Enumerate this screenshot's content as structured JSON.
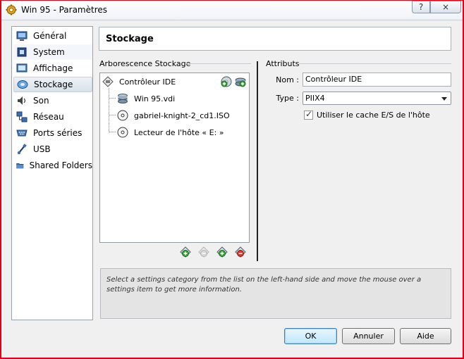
{
  "window": {
    "title": "Win 95 - Paramètres",
    "help_btn": "?",
    "close_btn": "×"
  },
  "sidebar": {
    "items": [
      {
        "label": "Général"
      },
      {
        "label": "System"
      },
      {
        "label": "Affichage"
      },
      {
        "label": "Stockage"
      },
      {
        "label": "Son"
      },
      {
        "label": "Réseau"
      },
      {
        "label": "Ports séries"
      },
      {
        "label": "USB"
      },
      {
        "label": "Shared Folders"
      }
    ],
    "selected": "Stockage"
  },
  "header": {
    "title": "Stockage"
  },
  "tree": {
    "section_label": "Arborescence Stockage",
    "controller": "Contrôleur IDE",
    "children": [
      {
        "label": "Win 95.vdi",
        "icon": "hard-disk-icon"
      },
      {
        "label": "gabriel-knight-2_cd1.ISO",
        "icon": "cd-icon"
      },
      {
        "label": "Lecteur de l'hôte « E: »",
        "icon": "cd-icon"
      }
    ]
  },
  "attributes": {
    "section_label": "Attributs",
    "name_label": "Nom :",
    "name_value": "Contrôleur IDE",
    "type_label": "Type :",
    "type_value": "PIIX4",
    "cache_label": "Utiliser le cache E/S de l'hôte",
    "cache_checked": true
  },
  "info": {
    "text": "Select a settings category from the list on the left-hand side and move the mouse over a settings item to get more information."
  },
  "buttons": {
    "ok": "OK",
    "cancel": "Annuler",
    "help": "Aide"
  },
  "colors": {
    "frame_border": "#e0001a",
    "default_button": "#3c7fb1"
  }
}
